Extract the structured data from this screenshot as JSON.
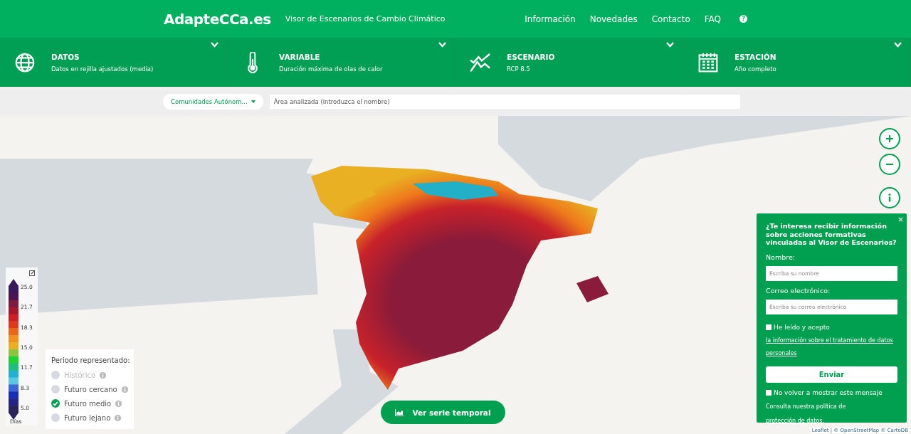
{
  "header": {
    "logo": "AdapteCCa.es",
    "subtitle": "Visor de Escenarios de Cambio Climático",
    "nav": [
      "Información",
      "Novedades",
      "Contacto",
      "FAQ"
    ],
    "help_icon": "?"
  },
  "selectors": [
    {
      "kind": "globe",
      "title": "DATOS",
      "value": "Datos en rejilla ajustados (media)"
    },
    {
      "kind": "thermometer",
      "title": "VARIABLE",
      "value": "Duración máxima de olas de calor"
    },
    {
      "kind": "trend",
      "title": "ESCENARIO",
      "value": "RCP 8.5"
    },
    {
      "kind": "calendar",
      "title": "ESTACIÓN",
      "value": "Año completo"
    }
  ],
  "search": {
    "region_dropdown": "Comunidades Autónom...",
    "placeholder": "Área analizada (introduzca el nombre)"
  },
  "legend": {
    "ticks": [
      "25.0",
      "21.7",
      "18.3",
      "15.0",
      "11.7",
      "8.3",
      "5.0"
    ],
    "unit": "Días"
  },
  "period": {
    "title": "Periodo representado:",
    "options": [
      {
        "label": "Histórico",
        "selected": false,
        "disabled": true
      },
      {
        "label": "Futuro cercano",
        "selected": false,
        "disabled": false
      },
      {
        "label": "Futuro medio",
        "selected": true,
        "disabled": false
      },
      {
        "label": "Futuro lejano",
        "selected": false,
        "disabled": false
      }
    ]
  },
  "series_button": "Ver serie temporal",
  "attribution": "Leaflet | © OpenStreetMap © CartoDB",
  "newsletter": {
    "question": "¿Te interesa recibir información sobre acciones formativas vinculadas al Visor de Escenarios?",
    "name_label": "Nombre:",
    "name_placeholder": "Escriba su nombre",
    "email_label": "Correo electrónico:",
    "email_placeholder": "Escriba su correo electrónico",
    "consent_text": "He leído y acepto",
    "consent_link": "la información sobre el tratamiento de datos personales",
    "consent_checked": false,
    "submit": "Enviar",
    "dont_show_text": "No volver a mostrar este mensaje",
    "dont_show_checked": false,
    "policy_text": "Consulta nuestra política de",
    "policy_link": "protección de datos",
    "policy_end": "."
  }
}
